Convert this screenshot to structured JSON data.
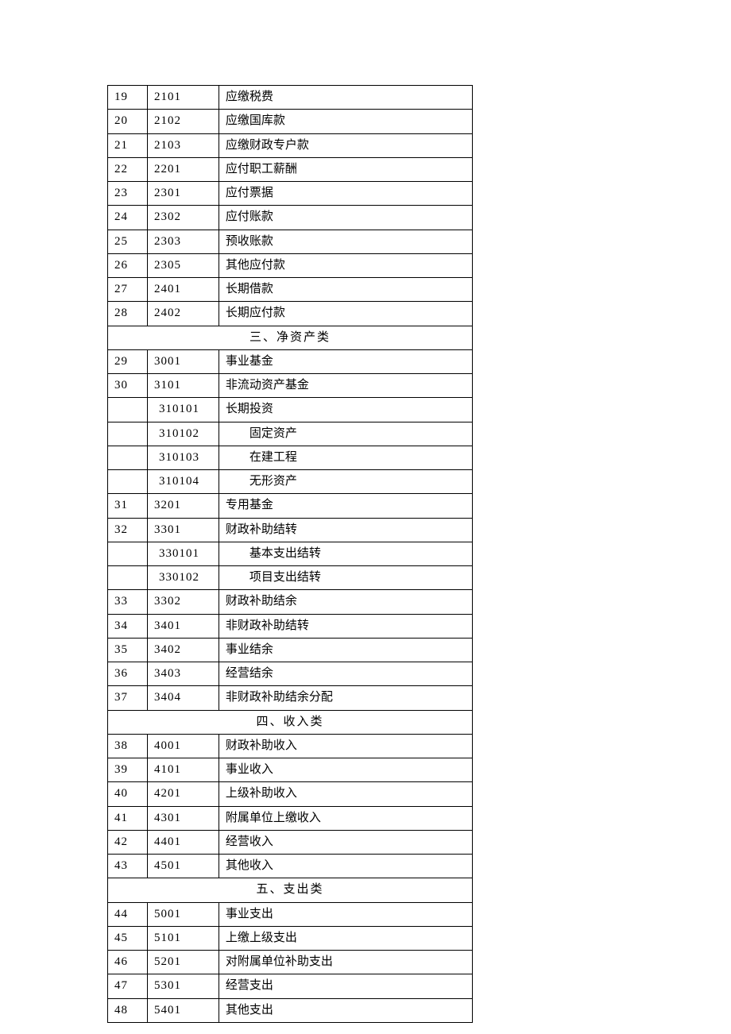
{
  "rows": [
    {
      "type": "row",
      "seq": "19",
      "code": "2101",
      "name": "应缴税费",
      "indent": 0
    },
    {
      "type": "row",
      "seq": "20",
      "code": "2102",
      "name": "应缴国库款",
      "indent": 0
    },
    {
      "type": "row",
      "seq": "21",
      "code": "2103",
      "name": "应缴财政专户款",
      "indent": 0
    },
    {
      "type": "row",
      "seq": "22",
      "code": "2201",
      "name": "应付职工薪酬",
      "indent": 0
    },
    {
      "type": "row",
      "seq": "23",
      "code": "2301",
      "name": "应付票据",
      "indent": 0
    },
    {
      "type": "row",
      "seq": "24",
      "code": "2302",
      "name": "应付账款",
      "indent": 0
    },
    {
      "type": "row",
      "seq": "25",
      "code": "2303",
      "name": "预收账款",
      "indent": 0
    },
    {
      "type": "row",
      "seq": "26",
      "code": "2305",
      "name": "其他应付款",
      "indent": 0
    },
    {
      "type": "row",
      "seq": "27",
      "code": "2401",
      "name": "长期借款",
      "indent": 0
    },
    {
      "type": "row",
      "seq": "28",
      "code": "2402",
      "name": "长期应付款",
      "indent": 0
    },
    {
      "type": "section",
      "title": "三、净资产类"
    },
    {
      "type": "row",
      "seq": "29",
      "code": "3001",
      "name": "事业基金",
      "indent": 0
    },
    {
      "type": "row",
      "seq": "30",
      "code": "3101",
      "name": "非流动资产基金",
      "indent": 0
    },
    {
      "type": "row",
      "seq": "",
      "code": "310101",
      "name": "长期投资",
      "indent": 0,
      "codeIndent": 1
    },
    {
      "type": "row",
      "seq": "",
      "code": "310102",
      "name": "固定资产",
      "indent": 1,
      "codeIndent": 1
    },
    {
      "type": "row",
      "seq": "",
      "code": "310103",
      "name": "在建工程",
      "indent": 1,
      "codeIndent": 1
    },
    {
      "type": "row",
      "seq": "",
      "code": "310104",
      "name": "无形资产",
      "indent": 1,
      "codeIndent": 1
    },
    {
      "type": "row",
      "seq": "31",
      "code": "3201",
      "name": "专用基金",
      "indent": 0
    },
    {
      "type": "row",
      "seq": "32",
      "code": "3301",
      "name": "财政补助结转",
      "indent": 0
    },
    {
      "type": "row",
      "seq": "",
      "code": "330101",
      "name": "基本支出结转",
      "indent": 1,
      "codeIndent": 1
    },
    {
      "type": "row",
      "seq": "",
      "code": "330102",
      "name": "项目支出结转",
      "indent": 1,
      "codeIndent": 1
    },
    {
      "type": "row",
      "seq": "33",
      "code": "3302",
      "name": "财政补助结余",
      "indent": 0
    },
    {
      "type": "row",
      "seq": "34",
      "code": "3401",
      "name": "非财政补助结转",
      "indent": 0
    },
    {
      "type": "row",
      "seq": "35",
      "code": "3402",
      "name": "事业结余",
      "indent": 0
    },
    {
      "type": "row",
      "seq": "36",
      "code": "3403",
      "name": "经营结余",
      "indent": 0
    },
    {
      "type": "row",
      "seq": "37",
      "code": "3404",
      "name": "非财政补助结余分配",
      "indent": 0
    },
    {
      "type": "section",
      "title": "四、收入类"
    },
    {
      "type": "row",
      "seq": "38",
      "code": "4001",
      "name": "财政补助收入",
      "indent": 0
    },
    {
      "type": "row",
      "seq": "39",
      "code": "4101",
      "name": "事业收入",
      "indent": 0
    },
    {
      "type": "row",
      "seq": "40",
      "code": "4201",
      "name": "上级补助收入",
      "indent": 0
    },
    {
      "type": "row",
      "seq": "41",
      "code": "4301",
      "name": "附属单位上缴收入",
      "indent": 0
    },
    {
      "type": "row",
      "seq": "42",
      "code": "4401",
      "name": "经营收入",
      "indent": 0
    },
    {
      "type": "row",
      "seq": "43",
      "code": "4501",
      "name": "其他收入",
      "indent": 0
    },
    {
      "type": "section",
      "title": "五、支出类"
    },
    {
      "type": "row",
      "seq": "44",
      "code": "5001",
      "name": "事业支出",
      "indent": 0
    },
    {
      "type": "row",
      "seq": "45",
      "code": "5101",
      "name": "上缴上级支出",
      "indent": 0
    },
    {
      "type": "row",
      "seq": "46",
      "code": "5201",
      "name": "对附属单位补助支出",
      "indent": 0
    },
    {
      "type": "row",
      "seq": "47",
      "code": "5301",
      "name": "经营支出",
      "indent": 0
    },
    {
      "type": "row",
      "seq": "48",
      "code": "5401",
      "name": "其他支出",
      "indent": 0
    }
  ]
}
